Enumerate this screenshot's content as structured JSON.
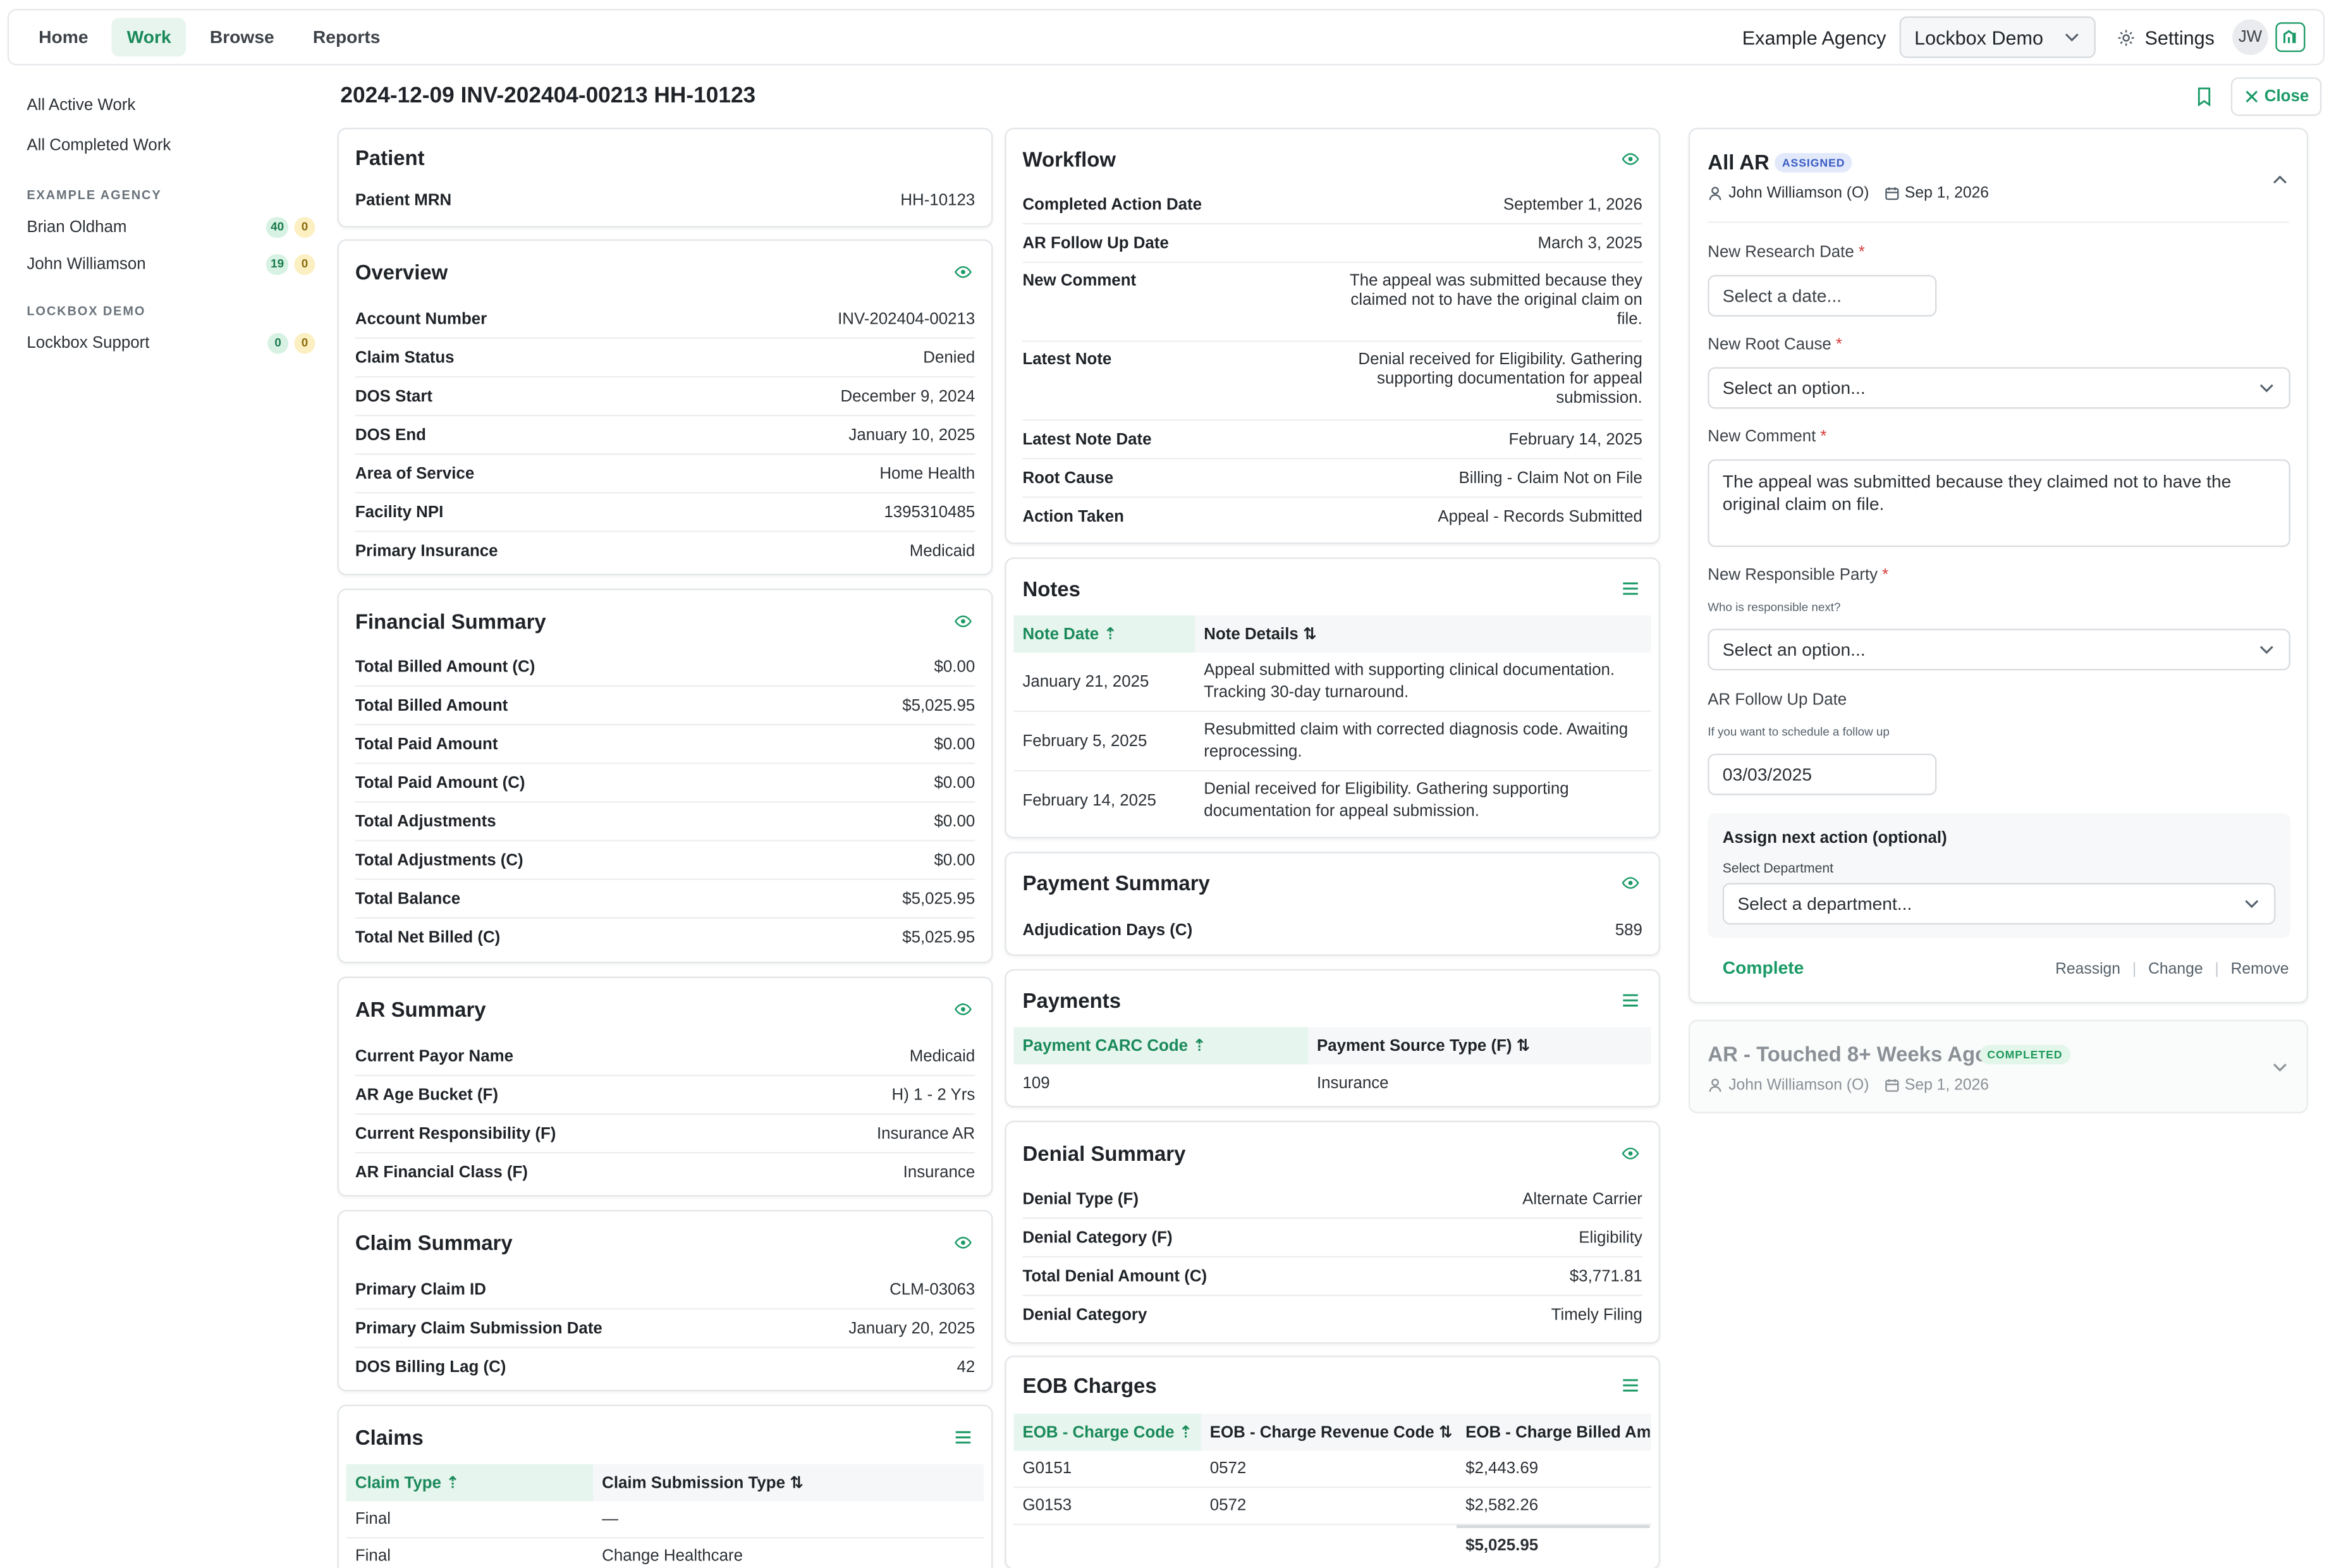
{
  "nav": {
    "tabs": [
      "Home",
      "Work",
      "Browse",
      "Reports"
    ],
    "agency": "Example Agency",
    "org_select": "Lockbox Demo",
    "settings": "Settings",
    "avatar_initials": "JW"
  },
  "sidebar": {
    "links": [
      "All Active Work",
      "All Completed Work"
    ],
    "groups": [
      {
        "heading": "EXAMPLE AGENCY",
        "users": [
          {
            "name": "Brian Oldham",
            "count_green": "40",
            "count_yellow": "0"
          },
          {
            "name": "John Williamson",
            "count_green": "19",
            "count_yellow": "0"
          }
        ]
      },
      {
        "heading": "LOCKBOX DEMO",
        "users": [
          {
            "name": "Lockbox Support",
            "count_green": "0",
            "count_yellow": "0"
          }
        ]
      }
    ]
  },
  "page": {
    "title": "2024-12-09 INV-202404-00213 HH-10123",
    "close_label": "Close"
  },
  "patient": {
    "title": "Patient",
    "rows": [
      {
        "label": "Patient MRN",
        "value": "HH-10123"
      }
    ]
  },
  "overview": {
    "title": "Overview",
    "rows": [
      {
        "label": "Account Number",
        "value": "INV-202404-00213"
      },
      {
        "label": "Claim Status",
        "value": "Denied"
      },
      {
        "label": "DOS Start",
        "value": "December 9, 2024"
      },
      {
        "label": "DOS End",
        "value": "January 10, 2025"
      },
      {
        "label": "Area of Service",
        "value": "Home Health"
      },
      {
        "label": "Facility NPI",
        "value": "1395310485"
      },
      {
        "label": "Primary Insurance",
        "value": "Medicaid"
      }
    ]
  },
  "financial": {
    "title": "Financial Summary",
    "rows": [
      {
        "label": "Total Billed Amount (C)",
        "value": "$0.00"
      },
      {
        "label": "Total Billed Amount",
        "value": "$5,025.95"
      },
      {
        "label": "Total Paid Amount",
        "value": "$0.00"
      },
      {
        "label": "Total Paid Amount (C)",
        "value": "$0.00"
      },
      {
        "label": "Total Adjustments",
        "value": "$0.00"
      },
      {
        "label": "Total Adjustments (C)",
        "value": "$0.00"
      },
      {
        "label": "Total Balance",
        "value": "$5,025.95"
      },
      {
        "label": "Total Net Billed (C)",
        "value": "$5,025.95"
      }
    ]
  },
  "ar_summary": {
    "title": "AR Summary",
    "rows": [
      {
        "label": "Current Payor Name",
        "value": "Medicaid"
      },
      {
        "label": "AR Age Bucket (F)",
        "value": "H) 1 - 2 Yrs"
      },
      {
        "label": "Current Responsibility (F)",
        "value": "Insurance AR"
      },
      {
        "label": "AR Financial Class (F)",
        "value": "Insurance"
      }
    ]
  },
  "claim_summary": {
    "title": "Claim Summary",
    "rows": [
      {
        "label": "Primary Claim ID",
        "value": "CLM-03063"
      },
      {
        "label": "Primary Claim Submission Date",
        "value": "January 20, 2025"
      },
      {
        "label": "DOS Billing Lag (C)",
        "value": "42"
      }
    ]
  },
  "claims": {
    "title": "Claims",
    "headers": [
      "Claim Type",
      "Claim Submission Type"
    ],
    "rows": [
      [
        "Final",
        "—"
      ],
      [
        "Final",
        "Change Healthcare"
      ]
    ]
  },
  "workflow": {
    "title": "Workflow",
    "rows": [
      {
        "label": "Completed Action Date",
        "value": "September 1, 2026"
      },
      {
        "label": "AR Follow Up Date",
        "value": "March 3, 2025"
      },
      {
        "label": "New Comment",
        "value": "The appeal was submitted because they claimed not to have the original claim on file."
      },
      {
        "label": "Latest Note",
        "value": "Denial received for Eligibility. Gathering supporting documentation for appeal submission."
      },
      {
        "label": "Latest Note Date",
        "value": "February 14, 2025"
      },
      {
        "label": "Root Cause",
        "value": "Billing - Claim Not on File"
      },
      {
        "label": "Action Taken",
        "value": "Appeal - Records Submitted"
      }
    ]
  },
  "notes": {
    "title": "Notes",
    "headers": [
      "Note Date",
      "Note Details"
    ],
    "rows": [
      [
        "January 21, 2025",
        "Appeal submitted with supporting clinical documentation. Tracking 30-day turnaround."
      ],
      [
        "February 5, 2025",
        "Resubmitted claim with corrected diagnosis code. Awaiting reprocessing."
      ],
      [
        "February 14, 2025",
        "Denial received for Eligibility. Gathering supporting documentation for appeal submission."
      ]
    ]
  },
  "payment_summary": {
    "title": "Payment Summary",
    "rows": [
      {
        "label": "Adjudication Days (C)",
        "value": "589"
      }
    ]
  },
  "payments": {
    "title": "Payments",
    "headers": [
      "Payment CARC Code",
      "Payment Source Type (F)"
    ],
    "rows": [
      [
        "109",
        "Insurance"
      ]
    ]
  },
  "denial_summary": {
    "title": "Denial Summary",
    "rows": [
      {
        "label": "Denial Type (F)",
        "value": "Alternate Carrier"
      },
      {
        "label": "Denial Category (F)",
        "value": "Eligibility"
      },
      {
        "label": "Total Denial Amount (C)",
        "value": "$3,771.81"
      },
      {
        "label": "Denial Category",
        "value": "Timely Filing"
      }
    ]
  },
  "eob": {
    "title": "EOB Charges",
    "headers": [
      "EOB - Charge Code",
      "EOB - Charge Revenue Code",
      "EOB - Charge Billed Amc"
    ],
    "rows": [
      [
        "G0151",
        "0572",
        "$2,443.69"
      ],
      [
        "G0153",
        "0572",
        "$2,582.26"
      ]
    ],
    "total": "$5,025.95"
  },
  "all_ar": {
    "title": "All AR",
    "badge": "ASSIGNED",
    "assignee": "John Williamson (O)",
    "date": "Sep 1, 2026",
    "research_label": "New Research Date",
    "research_placeholder": "Select a date...",
    "root_cause_label": "New Root Cause",
    "root_cause_placeholder": "Select an option...",
    "comment_label": "New Comment",
    "comment_value": "The appeal was submitted because they claimed not to have the original claim on file.",
    "party_label": "New Responsible Party",
    "party_hint": "Who is responsible next?",
    "party_placeholder": "Select an option...",
    "followup_label": "AR Follow Up Date",
    "followup_hint": "If you want to schedule a follow up",
    "followup_value": "03/03/2025",
    "assign_title": "Assign next action (optional)",
    "dept_label": "Select Department",
    "dept_placeholder": "Select a department...",
    "complete": "Complete",
    "reassign": "Reassign",
    "change": "Change",
    "remove": "Remove"
  },
  "ar_touched": {
    "title": "AR - Touched 8+ Weeks Ago",
    "badge": "COMPLETED",
    "assignee": "John Williamson (O)",
    "date": "Sep 1, 2026"
  },
  "colors": {
    "accent": "#1a9a66",
    "assigned_badge": "#3a5cc4",
    "required": "#d93a3a"
  }
}
